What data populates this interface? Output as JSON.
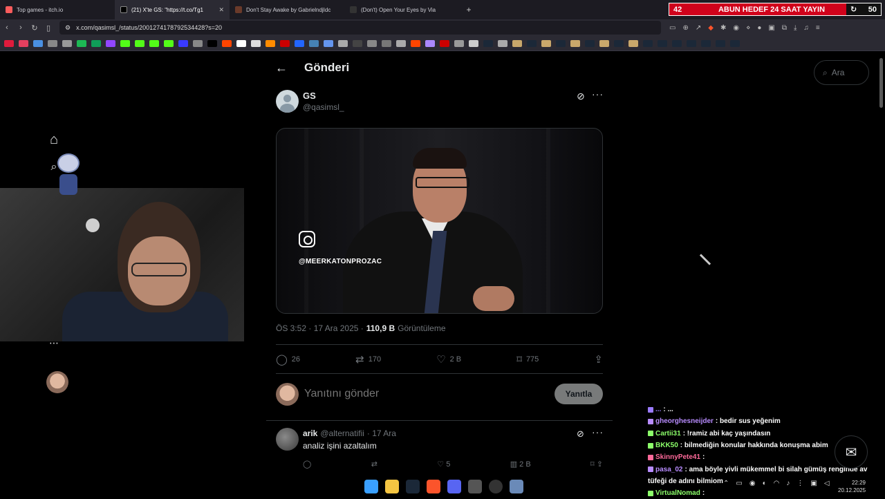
{
  "browser": {
    "tabs": [
      {
        "label": "Top games - itch.io",
        "active": false,
        "fav_color": "#fa5c5c"
      },
      {
        "label": "(21) X'te GS: \"https://t.co/Tg1",
        "active": true,
        "fav_color": "#000000"
      },
      {
        "label": "Don't Stay Awake by GabrielndjIdc",
        "active": false,
        "fav_color": "#6a3a2a"
      },
      {
        "label": "(Don't) Open Your Eyes by Via",
        "active": false,
        "fav_color": "#333333"
      }
    ],
    "new_tab": "+",
    "url": "x.com/qasimsl_/status/2001274178792534428?s=20",
    "stream_banner": {
      "left": "42",
      "middle": "ABUN HEDEF 24 SAAT YAYIN",
      "right": "50"
    }
  },
  "page": {
    "header_title": "Gönderi",
    "search_placeholder": "Ara",
    "post": {
      "author_name": "GS",
      "author_handle": "@qasimsl_",
      "media_watermark": "@MEERKATONPROZAC",
      "time": "ÖS 3:52 · 17 Ara 2025 ·",
      "views_count": "110,9 B",
      "views_label": "Görüntüleme",
      "replies": "26",
      "reposts": "170",
      "likes": "2 B",
      "bookmarks": "775"
    },
    "reply_placeholder": "Yanıtını gönder",
    "reply_button": "Yanıtla",
    "comment": {
      "name": "arik",
      "handle": "@alternatifii",
      "date": "· 17 Ara",
      "text": "analiz işini azaltalım",
      "likes": "5",
      "views": "2 B"
    }
  },
  "chat": [
    {
      "user": "...",
      "text": ": ...",
      "color": "#9b7bff"
    },
    {
      "user": "gheorghesneijder",
      "text": ": bedir sus yeğenim",
      "color": "#b88cff"
    },
    {
      "user": "Cartii31",
      "text": ": !ramiz abi kaç yaşındasın",
      "color": "#8cff6a"
    },
    {
      "user": "BKK50",
      "text": ": bilmediğin konular hakkında konuşma abim",
      "color": "#8cff6a"
    },
    {
      "user": "SkinnyPete41",
      "text": ":",
      "color": "#ff6a9a"
    },
    {
      "user": "pasa_02",
      "text": ": ama böyle yivli mükemmel bi silah gümüş renginde av",
      "color": "#b88cff"
    },
    {
      "user": "",
      "text": "tüfeği de adını bilmiom",
      "color": "#ffffff"
    },
    {
      "user": "VirtualNomad",
      "text": ":",
      "color": "#8cff6a"
    }
  ],
  "clock": {
    "time": "22:29",
    "date": "20.12.2025"
  }
}
